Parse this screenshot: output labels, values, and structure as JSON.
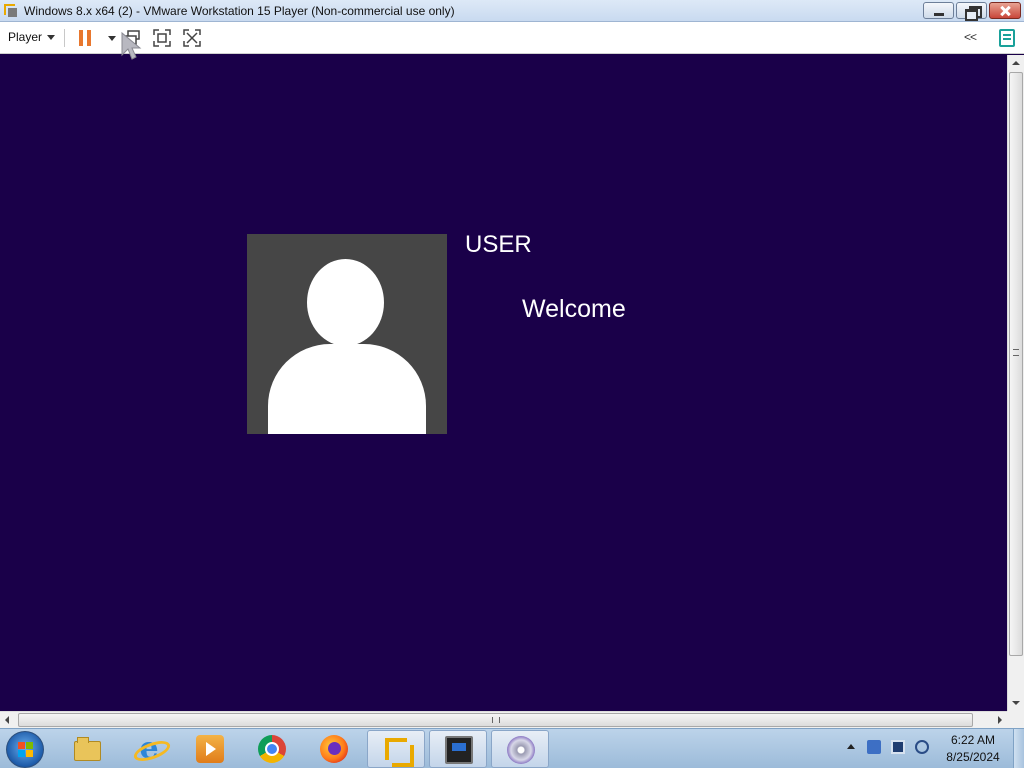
{
  "window": {
    "title": "Windows 8.x x64 (2) - VMware Workstation 15 Player (Non-commercial use only)",
    "buttons": {
      "minimize": "minimize-icon",
      "restore": "restore-icon",
      "close": "close-icon"
    }
  },
  "toolbar": {
    "player_menu": "Player",
    "collapse_label": "<<",
    "icons": [
      "pause-icon",
      "send-ctrl-alt-del-icon",
      "fullscreen-icon",
      "unity-icon",
      "notes-icon"
    ]
  },
  "vm": {
    "username": "USER",
    "status": "Welcome",
    "background_color": "#1a0049",
    "avatar_bg_color": "#464646"
  },
  "taskbar": {
    "start_icon": "windows-logo-icon",
    "pinned": [
      "file-explorer-icon",
      "internet-explorer-icon",
      "media-player-icon",
      "chrome-icon",
      "firefox-icon",
      "vmware-player-icon",
      "vm-console-icon",
      "dvd-icon"
    ],
    "tray_icons": [
      "show-hidden-icons-arrow",
      "network-icon",
      "display-icon",
      "volume-icon"
    ],
    "clock": {
      "time": "6:22 AM",
      "date": "8/25/2024"
    }
  }
}
